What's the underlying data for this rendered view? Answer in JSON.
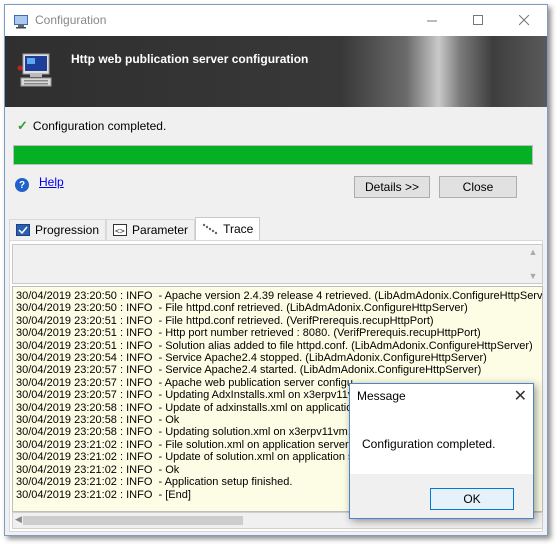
{
  "window": {
    "title": "Configuration",
    "icon": "configuration-window-icon",
    "controls": {
      "minimize": "minimize-icon",
      "maximize": "maximize-icon",
      "close": "close-icon"
    }
  },
  "banner": {
    "title": "Http web publication server configuration",
    "icon": "computer-icon"
  },
  "status": {
    "icon": "checkmark-icon",
    "text": "Configuration completed.",
    "progress_percent": 100,
    "progress_color": "#06b025"
  },
  "help": {
    "icon": "help-icon",
    "label": "Help"
  },
  "buttons": {
    "details": "Details >>",
    "close": "Close"
  },
  "tabs": [
    {
      "label": "Progression",
      "icon": "progression-icon",
      "active": false
    },
    {
      "label": "Parameter",
      "icon": "parameter-icon",
      "active": false
    },
    {
      "label": "Trace",
      "icon": "trace-icon",
      "active": true
    }
  ],
  "log_lines": [
    "30/04/2019 23:20:50 : INFO  - Apache version 2.4.39 release 4 retrieved. (LibAdmAdonix.ConfigureHttpServ",
    "30/04/2019 23:20:50 : INFO  - File httpd.conf retrieved. (LibAdmAdonix.ConfigureHttpServer)",
    "30/04/2019 23:20:51 : INFO  - File httpd.conf retrieved. (VerifPrerequis.recupHttpPort)",
    "30/04/2019 23:20:51 : INFO  - Http port number retrieved : 8080. (VerifPrerequis.recupHttpPort)",
    "30/04/2019 23:20:51 : INFO  - Solution alias added to file httpd.conf. (LibAdmAdonix.ConfigureHttpServer)",
    "30/04/2019 23:20:54 : INFO  - Service Apache2.4 stopped. (LibAdmAdonix.ConfigureHttpServer)",
    "30/04/2019 23:20:57 : INFO  - Service Apache2.4 started. (LibAdmAdonix.ConfigureHttpServer)",
    "30/04/2019 23:20:57 : INFO  - Apache web publication server configu",
    "30/04/2019 23:20:57 : INFO  - Updating AdxInstalls.xml on x3erpv11vm",
    "30/04/2019 23:20:58 : INFO  - Update of adxinstalls.xml on application",
    "30/04/2019 23:20:58 : INFO  - Ok",
    "30/04/2019 23:20:58 : INFO  - Updating solution.xml on x3erpv11vm...",
    "30/04/2019 23:21:02 : INFO  - File solution.xml on application server u",
    "30/04/2019 23:21:02 : INFO  - Update of solution.xml on application se",
    "30/04/2019 23:21:02 : INFO  - Ok",
    "30/04/2019 23:21:02 : INFO  - Application setup finished.",
    "30/04/2019 23:21:02 : INFO  - [End]"
  ],
  "dialog": {
    "title": "Message",
    "message": "Configuration completed.",
    "ok_label": "OK",
    "close_icon": "close-icon"
  }
}
